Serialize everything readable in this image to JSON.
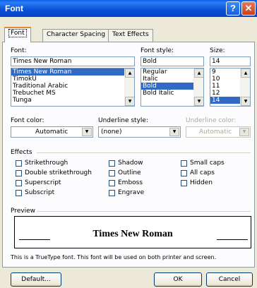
{
  "window": {
    "title": "Font",
    "help_label": "?",
    "close_label": "✕"
  },
  "tabs": [
    {
      "label": "Font"
    },
    {
      "label": "Character Spacing"
    },
    {
      "label": "Text Effects"
    }
  ],
  "font": {
    "label": "Font:",
    "value": "Times New Roman",
    "items": [
      "Times New Roman",
      "TimokU",
      "Traditional Arabic",
      "Trebuchet MS",
      "Tunga"
    ],
    "selected_index": 0
  },
  "font_style": {
    "label": "Font style:",
    "value": "Bold",
    "items": [
      "Regular",
      "Italic",
      "Bold",
      "Bold Italic"
    ],
    "selected_index": 2
  },
  "size": {
    "label": "Size:",
    "value": "14",
    "items": [
      "9",
      "10",
      "11",
      "12",
      "14"
    ],
    "selected_index": 4
  },
  "font_color": {
    "label": "Font color:",
    "value": "Automatic"
  },
  "underline_style": {
    "label": "Underline style:",
    "value": "(none)"
  },
  "underline_color": {
    "label": "Underline color:",
    "value": "Automatic"
  },
  "effects": {
    "label": "Effects",
    "items": [
      "Strikethrough",
      "Double strikethrough",
      "Superscript",
      "Subscript",
      "Shadow",
      "Outline",
      "Emboss",
      "Engrave",
      "Small caps",
      "All caps",
      "Hidden"
    ]
  },
  "preview": {
    "label": "Preview",
    "sample": "Times New Roman",
    "note": "This is a TrueType font. This font will be used on both printer and screen."
  },
  "buttons": {
    "default": "Default...",
    "ok": "OK",
    "cancel": "Cancel"
  },
  "icons": {
    "up": "scroll-up-arrow",
    "down": "scroll-down-arrow"
  }
}
